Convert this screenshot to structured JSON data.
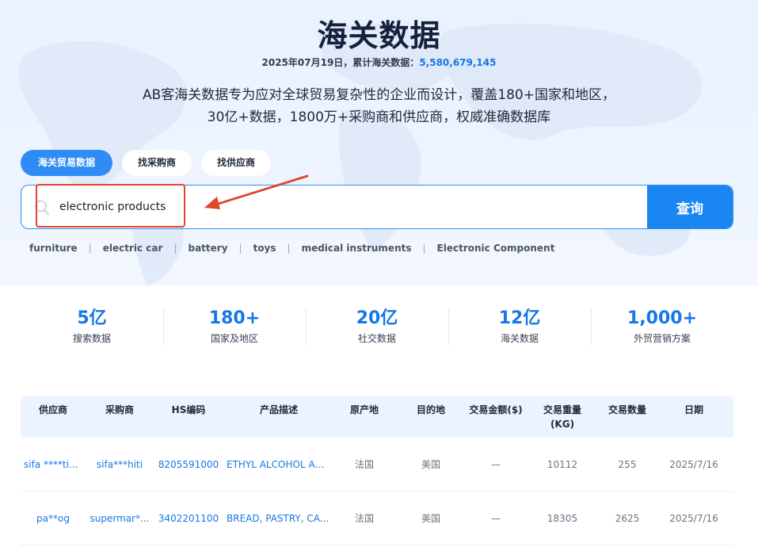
{
  "hero": {
    "title": "海关数据",
    "date_prefix": "2025年07月19日，累计海关数据：",
    "total_count": "5,580,679,145",
    "desc_line1": "AB客海关数据专为应对全球贸易复杂性的企业而设计，覆盖180+国家和地区，",
    "desc_line2": "30亿+数据，1800万+采购商和供应商，权威准确数据库"
  },
  "tabs": [
    {
      "label": "海关贸易数据",
      "active": true
    },
    {
      "label": "找采购商",
      "active": false
    },
    {
      "label": "找供应商",
      "active": false
    }
  ],
  "search": {
    "value": "electronic products",
    "button_label": "查询",
    "icon": "search-icon"
  },
  "quick_keywords": [
    "furniture",
    "electric car",
    "battery",
    "toys",
    "medical instruments",
    "Electronic Component"
  ],
  "stats": [
    {
      "value": "5亿",
      "label": "搜索数据"
    },
    {
      "value": "180+",
      "label": "国家及地区"
    },
    {
      "value": "20亿",
      "label": "社交数据"
    },
    {
      "value": "12亿",
      "label": "海关数据"
    },
    {
      "value": "1,000+",
      "label": "外贸营销方案"
    }
  ],
  "table": {
    "headers": [
      "供应商",
      "采购商",
      "HS编码",
      "产品描述",
      "原产地",
      "目的地",
      "交易金额($)",
      "交易重量",
      "(KG)",
      "交易数量",
      "日期"
    ],
    "rows": [
      [
        "sifa ****time",
        "sifa***hiti",
        "8205591000",
        "ETHYL ALCOHOL AN...",
        "法国",
        "美国",
        "—",
        "10112",
        "255",
        "2025/7/16"
      ],
      [
        "pa**og",
        "supermar*...",
        "3402201100",
        "BREAD, PASTRY, CA...",
        "法国",
        "美国",
        "—",
        "18305",
        "2625",
        "2025/7/16"
      ]
    ]
  },
  "colors": {
    "accent": "#1677e6",
    "button": "#1a86f2",
    "annotation": "#e0452d",
    "table_header_bg": "#eaf3fe"
  }
}
